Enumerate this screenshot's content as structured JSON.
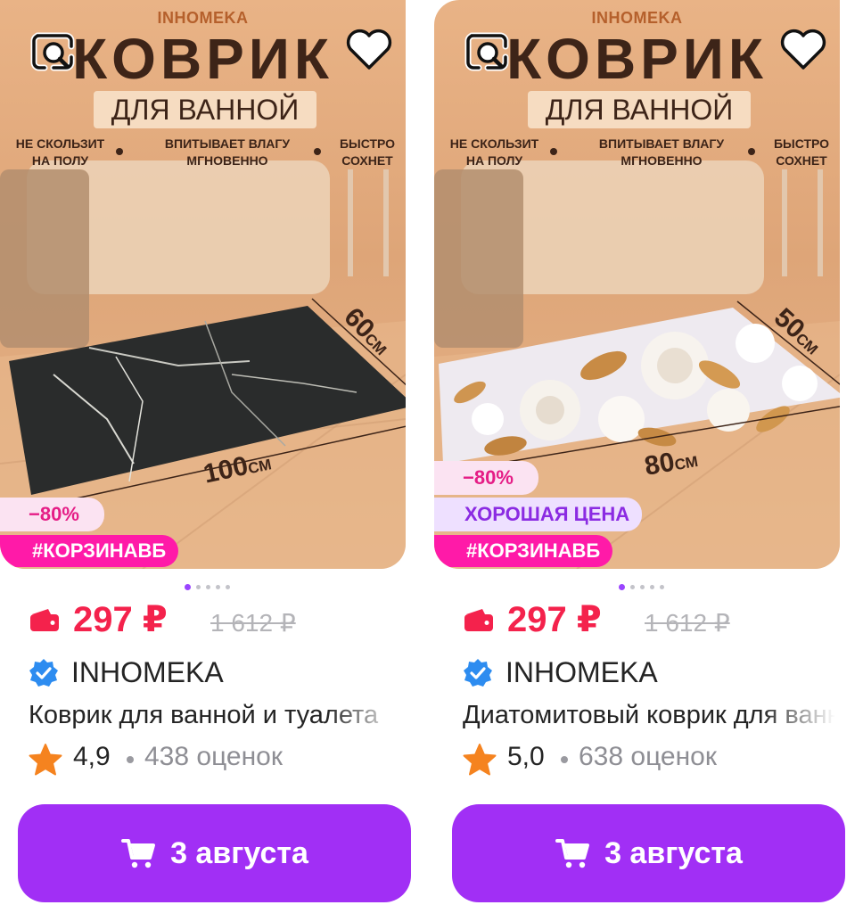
{
  "products": [
    {
      "image": {
        "brand": "INHOMEKA",
        "headline": "КОВРИК",
        "subheadline": "ДЛЯ ВАННОЙ",
        "features": [
          "НЕ СКОЛЬЗИТ НА ПОЛУ",
          "ВПИТЫВАЕТ ВЛАГУ МГНОВЕННО",
          "БЫСТРО СОХНЕТ"
        ],
        "width_label": "100",
        "height_label": "60",
        "unit": "СМ",
        "mat_pattern": "black-marble"
      },
      "discount_badge": "−80%",
      "promo_badge": "",
      "tag_badge": "#КОРЗИНАВБ",
      "carousel": {
        "count": 5,
        "active": 0
      },
      "price": "297 ₽",
      "old_price": "1 612 ₽",
      "seller": "INHOMEKA",
      "title": "Коврик для ванной и туалета",
      "rating": "4,9",
      "reviews": "438 оценок",
      "delivery": "3 августа"
    },
    {
      "image": {
        "brand": "INHOMEKA",
        "headline": "КОВРИК",
        "subheadline": "ДЛЯ ВАННОЙ",
        "features": [
          "НЕ СКОЛЬЗИТ НА ПОЛУ",
          "ВПИТЫВАЕТ ВЛАГУ МГНОВЕННО",
          "БЫСТРО СОХНЕТ"
        ],
        "width_label": "80",
        "height_label": "50",
        "unit": "СМ",
        "mat_pattern": "white-gold-flowers"
      },
      "discount_badge": "−80%",
      "promo_badge": "ХОРОШАЯ ЦЕНА",
      "tag_badge": "#КОРЗИНАВБ",
      "carousel": {
        "count": 5,
        "active": 0
      },
      "price": "297 ₽",
      "old_price": "1 612 ₽",
      "seller": "INHOMEKA",
      "title": "Диатомитовый коврик для ванной",
      "rating": "5,0",
      "reviews": "638 оценок",
      "delivery": "3 августа"
    }
  ],
  "colors": {
    "price": "#f4224c",
    "button": "#a12ff5",
    "tag": "#ff1aa8",
    "discount_text": "#e51d86",
    "promo_text": "#8b2be2",
    "star": "#f5831f",
    "verified": "#2d8cf0"
  },
  "icons": [
    "search-similar-icon",
    "heart-icon",
    "wallet-icon",
    "verified-icon",
    "star-icon",
    "cart-icon"
  ]
}
